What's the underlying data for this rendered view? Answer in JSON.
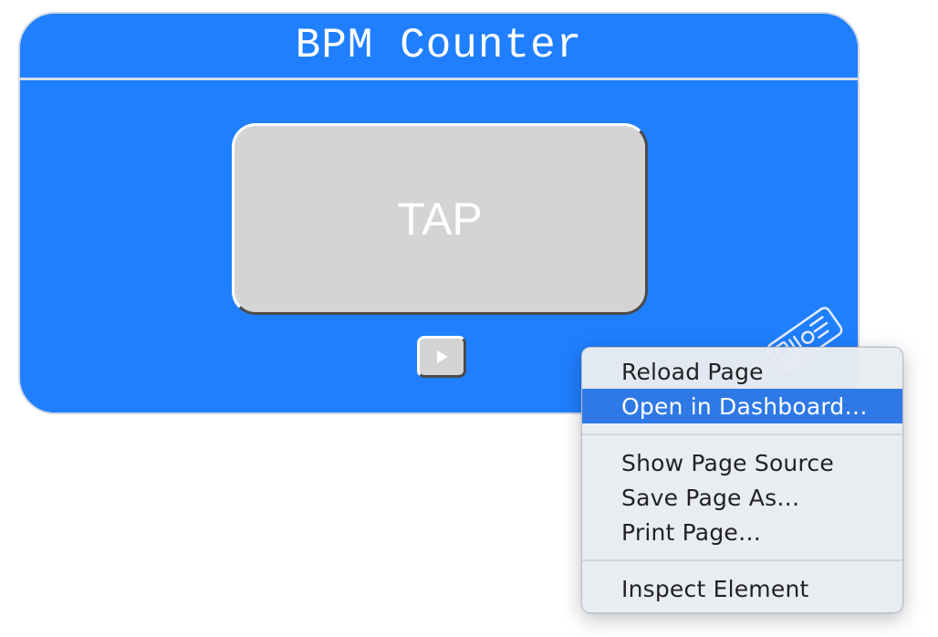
{
  "widget": {
    "title": "BPM Counter",
    "tap_label": "TAP",
    "play_icon": "play-icon",
    "info_icon": "info-icon",
    "accent_color": "#1f7fff"
  },
  "context_menu": {
    "highlight_color": "#2f79e6",
    "groups": [
      [
        {
          "label": "Reload Page",
          "highlighted": false
        },
        {
          "label": "Open in Dashboard…",
          "highlighted": true
        }
      ],
      [
        {
          "label": "Show Page Source",
          "highlighted": false
        },
        {
          "label": "Save Page As…",
          "highlighted": false
        },
        {
          "label": "Print Page…",
          "highlighted": false
        }
      ],
      [
        {
          "label": "Inspect Element",
          "highlighted": false
        }
      ]
    ]
  }
}
